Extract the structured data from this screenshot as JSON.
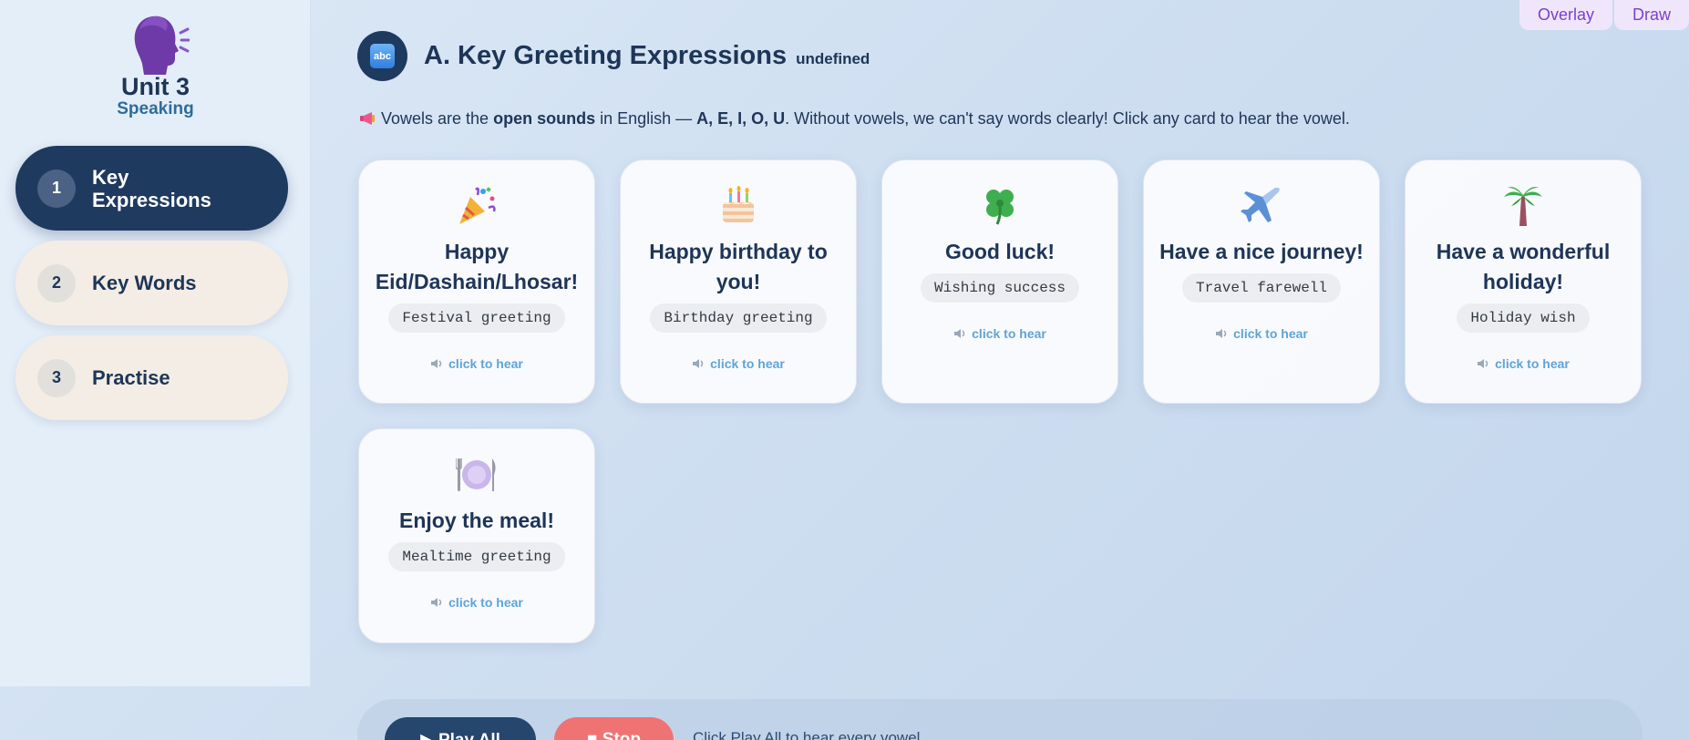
{
  "topbar": {
    "overlay_label": "Overlay",
    "draw_label": "Draw"
  },
  "sidebar": {
    "unit_title": "Unit 3",
    "unit_subtitle": "Speaking",
    "items": [
      {
        "number": "1",
        "label": "Key Expressions",
        "active": true
      },
      {
        "number": "2",
        "label": "Key Words",
        "active": false
      },
      {
        "number": "3",
        "label": "Practise",
        "active": false
      }
    ]
  },
  "header": {
    "badge_text": "abc",
    "title": "A. Key Greeting Expressions",
    "subtitle": "undefined"
  },
  "intro": {
    "text_1": "Vowels are the ",
    "bold_1": "open sounds",
    "text_2": " in English — ",
    "bold_2": "A, E, I, O, U",
    "text_3": ". Without vowels, we can't say words clearly! Click any card to hear the vowel."
  },
  "cards": [
    {
      "icon": "party-popper-icon",
      "title": "Happy Eid/Dashain/Lhosar!",
      "tag": "Festival greeting",
      "hear": "click to hear"
    },
    {
      "icon": "birthday-cake-icon",
      "title": "Happy birthday to you!",
      "tag": "Birthday greeting",
      "hear": "click to hear"
    },
    {
      "icon": "four-leaf-clover-icon",
      "title": "Good luck!",
      "tag": "Wishing success",
      "hear": "click to hear"
    },
    {
      "icon": "airplane-icon",
      "title": "Have a nice journey!",
      "tag": "Travel farewell",
      "hear": "click to hear"
    },
    {
      "icon": "palm-tree-icon",
      "title": "Have a wonderful holiday!",
      "tag": "Holiday wish",
      "hear": "click to hear"
    },
    {
      "icon": "plate-cutlery-icon",
      "title": "Enjoy the meal!",
      "tag": "Mealtime greeting",
      "hear": "click to hear"
    }
  ],
  "controls": {
    "play_all_label": "▶ Play All",
    "stop_label": "■ Stop",
    "hint": "Click Play All to hear every vowel"
  },
  "colors": {
    "navy": "#1f3a5f",
    "accent_blue": "#5fa4d8",
    "stop_red": "#f07373",
    "pill_beige": "#f3ede6",
    "topbar_purple": "#7a3fd0"
  }
}
